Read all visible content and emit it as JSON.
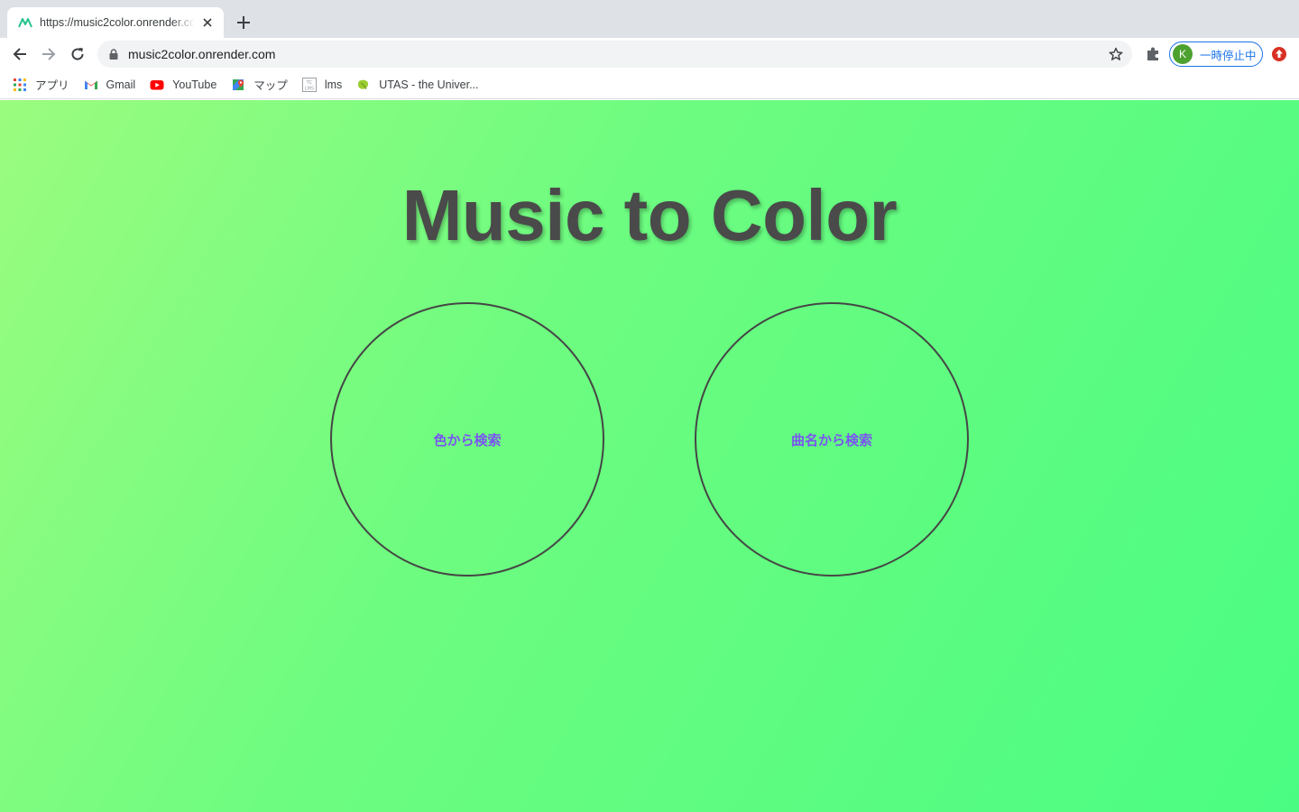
{
  "browser": {
    "tab": {
      "title": "https://music2color.onrender.com",
      "favicon": "music2color-favicon"
    },
    "new_tab_icon": "plus-icon",
    "address_bar": {
      "url": "music2color.onrender.com"
    },
    "profile": {
      "initial": "K",
      "label": "一時停止中"
    },
    "bookmarks": [
      {
        "label": "アプリ",
        "icon": "apps-grid-icon"
      },
      {
        "label": "Gmail",
        "icon": "gmail-icon"
      },
      {
        "label": "YouTube",
        "icon": "youtube-icon"
      },
      {
        "label": "マップ",
        "icon": "maps-icon"
      },
      {
        "label": "lms",
        "icon": "lms-icon"
      },
      {
        "label": "UTAS - the Univer...",
        "icon": "utas-leaf-icon"
      }
    ]
  },
  "page": {
    "title": "Music to Color",
    "buttons": {
      "color_search": "色から検索",
      "song_search": "曲名から検索"
    }
  },
  "colors": {
    "gradient_start": "#9afc7f",
    "gradient_end": "#4afd82",
    "title": "#4a4a4a",
    "button_text": "#7a54f0",
    "circle_border": "#454545"
  }
}
